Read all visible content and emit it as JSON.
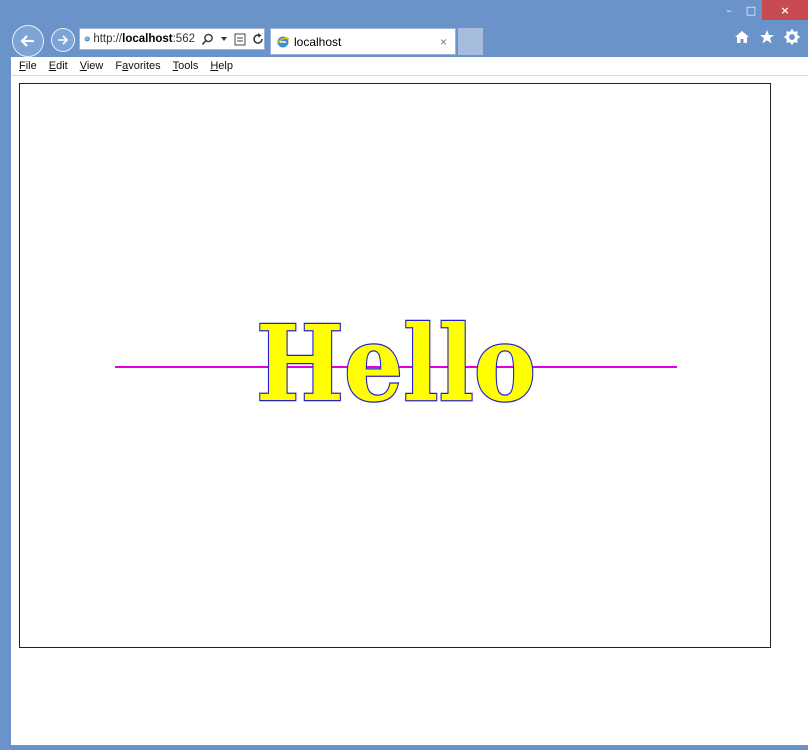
{
  "browser": {
    "address": {
      "prefix": "http://",
      "host": "localhost",
      "port": ":562"
    },
    "tab": {
      "title": "localhost",
      "close_glyph": "×"
    },
    "window_controls": {
      "minimize": "–",
      "maximize": "□",
      "close": "×"
    },
    "right_icons": [
      "home-icon",
      "favorites-star-icon",
      "settings-gear-icon"
    ]
  },
  "menu": {
    "items": [
      {
        "underline": "F",
        "rest": "ile"
      },
      {
        "underline": "E",
        "rest": "dit"
      },
      {
        "underline": "V",
        "rest": "iew"
      },
      {
        "prefix": "F",
        "underline": "a",
        "rest": "vorites"
      },
      {
        "underline": "T",
        "rest": "ools"
      },
      {
        "underline": "H",
        "rest": "elp"
      }
    ]
  },
  "canvas": {
    "text": "Hello",
    "text_fill": "#ffff00",
    "text_stroke": "#2222cc",
    "line_color": "#e000e0"
  }
}
